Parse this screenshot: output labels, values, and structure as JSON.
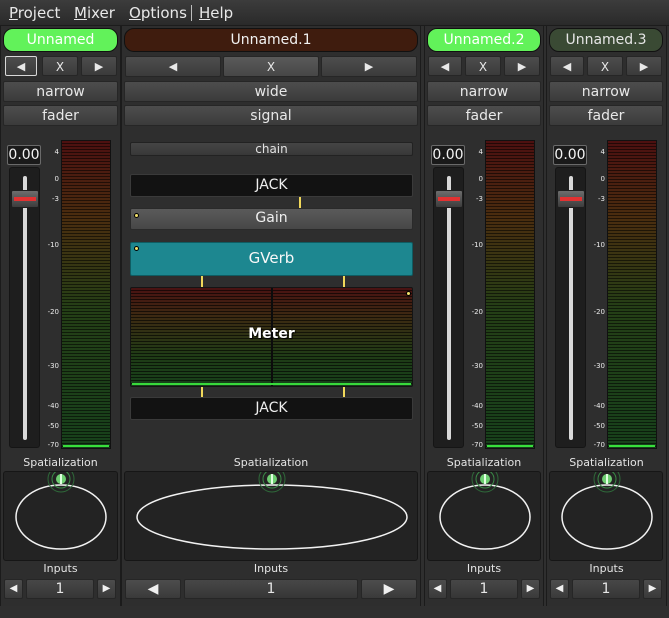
{
  "menubar": {
    "items": [
      {
        "accel": "P",
        "rest": "roject"
      },
      {
        "accel": "M",
        "rest": "ixer"
      },
      {
        "accel": "O",
        "rest": "ptions"
      },
      {
        "accel": "H",
        "rest": "elp"
      }
    ]
  },
  "colors": {
    "active_name": "#62f25a",
    "selected_name": "#3f1c0e",
    "inactive_name": "#3a4a34",
    "meter_floor": "#38e03c",
    "gverb": "#1d8790",
    "fader_marker": "#e23232"
  },
  "strips": [
    {
      "name": "Unnamed",
      "width_label": "narrow",
      "view_label": "fader",
      "gain": "0.00",
      "arrow_left": "◀",
      "arrow_right": "▶",
      "close": "X",
      "spatialization_label": "Spatialization",
      "inputs_label": "Inputs",
      "inputs_value": "1"
    },
    {
      "name": "Unnamed.1",
      "width_label": "wide",
      "view_label": "signal",
      "arrow_left": "◀",
      "arrow_right": "▶",
      "close": "X",
      "chain_label": "chain",
      "modules": [
        "JACK",
        "Gain",
        "GVerb",
        "Meter",
        "JACK"
      ],
      "spatialization_label": "Spatialization",
      "inputs_label": "Inputs",
      "inputs_value": "1"
    },
    {
      "name": "Unnamed.2",
      "width_label": "narrow",
      "view_label": "fader",
      "gain": "0.00",
      "arrow_left": "◀",
      "arrow_right": "▶",
      "close": "X",
      "spatialization_label": "Spatialization",
      "inputs_label": "Inputs",
      "inputs_value": "1"
    },
    {
      "name": "Unnamed.3",
      "width_label": "narrow",
      "view_label": "fader",
      "gain": "0.00",
      "arrow_left": "◀",
      "arrow_right": "▶",
      "close": "X",
      "spatialization_label": "Spatialization",
      "inputs_label": "Inputs",
      "inputs_value": "1"
    }
  ],
  "meter_scale": [
    "4",
    "0",
    "-3",
    "-10",
    "-20",
    "-30",
    "-40",
    "-50",
    "-70"
  ],
  "spin": {
    "left": "◀",
    "right": "▶"
  }
}
